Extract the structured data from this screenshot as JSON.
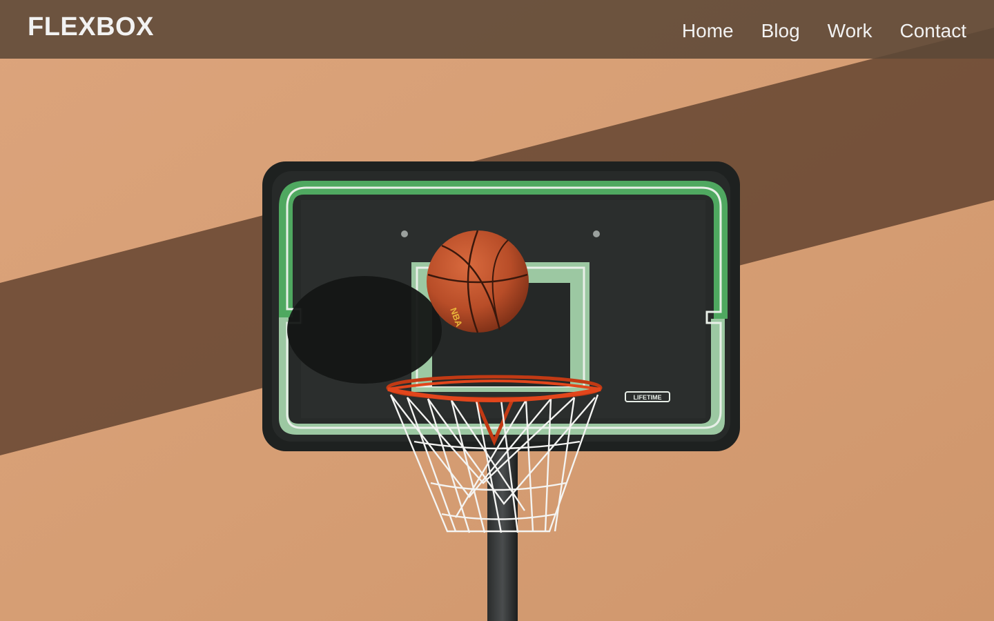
{
  "header": {
    "logo": "FLEXBOX",
    "nav": [
      {
        "label": "Home"
      },
      {
        "label": "Blog"
      },
      {
        "label": "Work"
      },
      {
        "label": "Contact"
      }
    ]
  },
  "hero": {
    "image_subject": "basketball hoop with ball against orange wall",
    "backboard_brand": "LIFETIME",
    "ball_brand": "NBA"
  },
  "colors": {
    "header_bg": "#5c4837",
    "header_text": "#f2f2f2",
    "wall": "#d9a47a",
    "backboard": "#1f2221",
    "backboard_trim": "#4aa65a",
    "rim": "#e2461c",
    "ball": "#c0552f"
  }
}
